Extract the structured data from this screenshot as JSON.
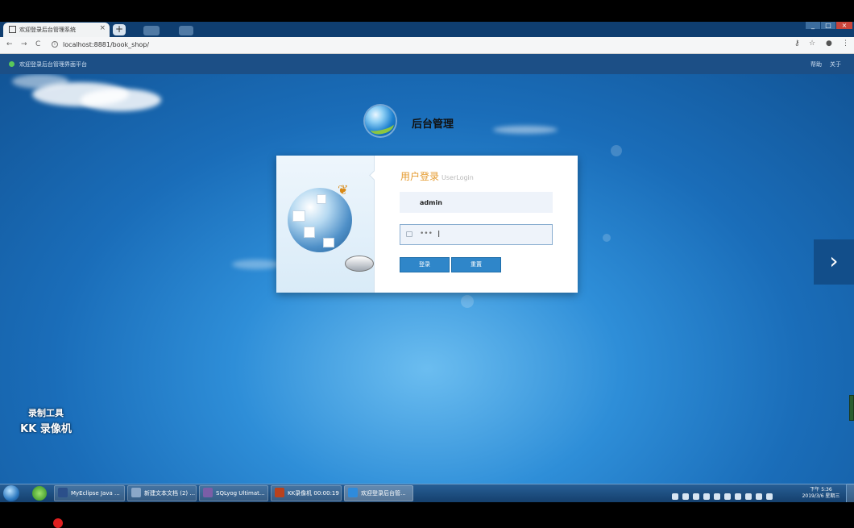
{
  "browser": {
    "tab_title": "欢迎登录后台管理系统",
    "tab_close": "×",
    "new_tab": "+",
    "url": "localhost:8881/book_shop/",
    "window_controls": [
      "_",
      "□",
      "×"
    ],
    "nav_icons": [
      "back-icon",
      "forward-icon",
      "reload-icon"
    ]
  },
  "header": {
    "title": "欢迎登录后台管理界面平台",
    "links": [
      "帮助",
      "关于"
    ]
  },
  "brand": {
    "title": "后台管理"
  },
  "login": {
    "heading": "用户登录",
    "heading_sub": "UserLogin",
    "username_value": "admin",
    "password_display": "•••",
    "login_button": "登录",
    "reset_button": "重置"
  },
  "watermark": {
    "line1": "录制工具",
    "line2": "KK 录像机"
  },
  "taskbar": {
    "tasks": [
      {
        "label": "MyEclipse Java ...",
        "color": "#2b4f8a"
      },
      {
        "label": "新建文本文档 (2) ...",
        "color": "#8aa7c8"
      },
      {
        "label": "SQLyog Ultimat...",
        "color": "#7b5ea7"
      },
      {
        "label": "KK录像机 00:00:19",
        "color": "#b8421e"
      },
      {
        "label": "欢迎登录后台管...",
        "color": "#2e8bdc"
      }
    ],
    "clock_time": "下午 5:36",
    "clock_date": "2019/3/6 星期三"
  },
  "colors": {
    "accent": "#2f86c9",
    "heading": "#e59a2e",
    "header_bg": "#1c4f86"
  }
}
